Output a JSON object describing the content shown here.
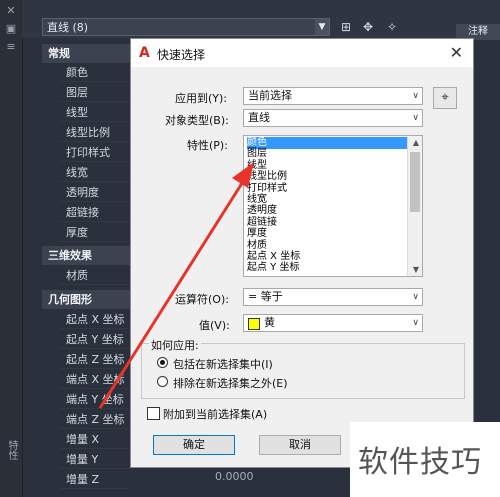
{
  "palette": {
    "title": "特性",
    "type_select": "直线 (8)",
    "sections": {
      "general": "常规",
      "three_d": "三维效果",
      "geometry": "几何图形"
    },
    "general_rows": [
      "颜色",
      "图层",
      "线型",
      "线型比例",
      "打印样式",
      "线宽",
      "透明度",
      "超链接",
      "厚度"
    ],
    "three_d_rows": [
      "材质"
    ],
    "geometry_rows": [
      "起点 X 坐标",
      "起点 Y 坐标",
      "起点 Z 坐标",
      "端点 X 坐标",
      "端点 Y 坐标",
      "端点 Z 坐标",
      "增量 X",
      "增量 Y",
      "增量 Z"
    ],
    "bottom_value": "0.0000",
    "annot_tab": "注释"
  },
  "dialog": {
    "title": "快速选择",
    "apply_to_label": "应用到(Y):",
    "apply_to_value": "当前选择",
    "object_type_label": "对象类型(B):",
    "object_type_value": "直线",
    "properties_label": "特性(P):",
    "properties": [
      "颜色",
      "图层",
      "线型",
      "线型比例",
      "打印样式",
      "线宽",
      "透明度",
      "超链接",
      "厚度",
      "材质",
      "起点 X 坐标",
      "起点 Y 坐标"
    ],
    "selected_property": "颜色",
    "operator_label": "运算符(O):",
    "operator_value": "= 等于",
    "value_label": "值(V):",
    "value_value": "黄",
    "how_to_apply_label": "如何应用:",
    "include_label": "包括在新选择集中(I)",
    "exclude_label": "排除在新选择集之外(E)",
    "append_label": "附加到当前选择集(A)",
    "ok_label": "确定",
    "cancel_label": "取消"
  },
  "watermark": "软件技巧",
  "colors": {
    "accent_selection": "#3399ff",
    "arrow": "#e8332b",
    "swatch_yellow": "#ffff00"
  }
}
